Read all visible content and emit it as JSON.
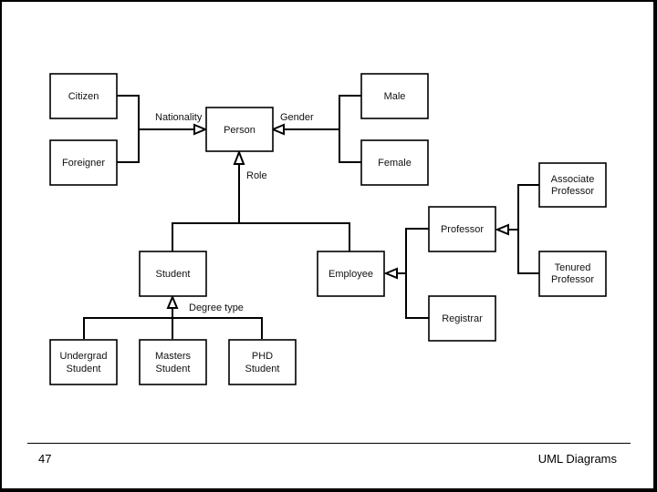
{
  "slide": {
    "page_number": "47",
    "footer_title": "UML Diagrams"
  },
  "diagram": {
    "type": "UML class generalization hierarchy",
    "classes": {
      "citizen": "Citizen",
      "foreigner": "Foreigner",
      "person": "Person",
      "male": "Male",
      "female": "Female",
      "student": "Student",
      "employee": "Employee",
      "professor": "Professor",
      "registrar": "Registrar",
      "associate_professor": [
        "Associate",
        "Professor"
      ],
      "tenured_professor": [
        "Tenured",
        "Professor"
      ],
      "undergrad_student": [
        "Undergrad",
        "Student"
      ],
      "masters_student": [
        "Masters",
        "Student"
      ],
      "phd_student": [
        "PHD",
        "Student"
      ]
    },
    "discriminators": {
      "nationality": "Nationality",
      "gender": "Gender",
      "role": "Role",
      "degree_type": "Degree type"
    },
    "generalizations": [
      {
        "parent": "Person",
        "children": [
          "Citizen",
          "Foreigner"
        ],
        "discriminator": "Nationality"
      },
      {
        "parent": "Person",
        "children": [
          "Male",
          "Female"
        ],
        "discriminator": "Gender"
      },
      {
        "parent": "Person",
        "children": [
          "Student",
          "Employee"
        ],
        "discriminator": "Role"
      },
      {
        "parent": "Student",
        "children": [
          "Undergrad Student",
          "Masters Student",
          "PHD Student"
        ],
        "discriminator": "Degree type"
      },
      {
        "parent": "Employee",
        "children": [
          "Professor",
          "Registrar"
        ],
        "discriminator": ""
      },
      {
        "parent": "Professor",
        "children": [
          "Associate Professor",
          "Tenured Professor"
        ],
        "discriminator": ""
      }
    ]
  }
}
